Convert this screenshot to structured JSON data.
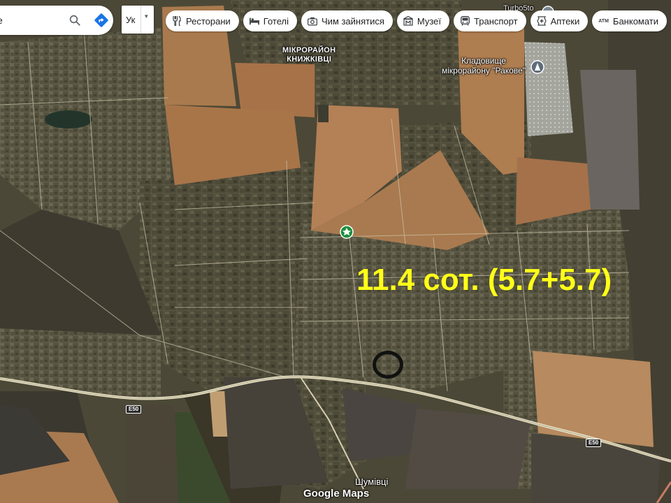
{
  "search": {
    "value": "е",
    "search_icon": "search-icon",
    "directions_icon": "directions-icon",
    "directions_color": "#1a73e8"
  },
  "language": {
    "selected": "Ук",
    "caret_icon": "caret-down-icon"
  },
  "chips": [
    {
      "label": "Ресторани",
      "icon": "restaurant-icon"
    },
    {
      "label": "Готелі",
      "icon": "hotel-icon"
    },
    {
      "label": "Чим зайнятися",
      "icon": "camera-icon"
    },
    {
      "label": "Музеї",
      "icon": "museum-icon"
    },
    {
      "label": "Транспорт",
      "icon": "transit-icon"
    },
    {
      "label": "Аптеки",
      "icon": "pharmacy-icon"
    },
    {
      "label": "Банкомати",
      "icon": "atm-icon",
      "icon_text": "ATM"
    }
  ],
  "map": {
    "district_line1": "МІКРОРАЙОН",
    "district_line2": "КНИЖКІВЦІ",
    "cemetery_line1": "Кладовище",
    "cemetery_line2": "мікрорайону \"Ракове\"",
    "village": "Шумівці",
    "road_ref": "E50",
    "corner_partial": "Turbo5to",
    "annotation": "11.4 сот. (5.7+5.7)",
    "annotation_color": "#ffff19",
    "marker_color": "#111111",
    "logo": "Google Maps"
  },
  "colors": {
    "field_light": "#b07a48",
    "field_dark": "#3f3a32",
    "settlement": "#5b5a48",
    "road": "#e8e2c8",
    "cemetery": "#a8a8a0"
  }
}
